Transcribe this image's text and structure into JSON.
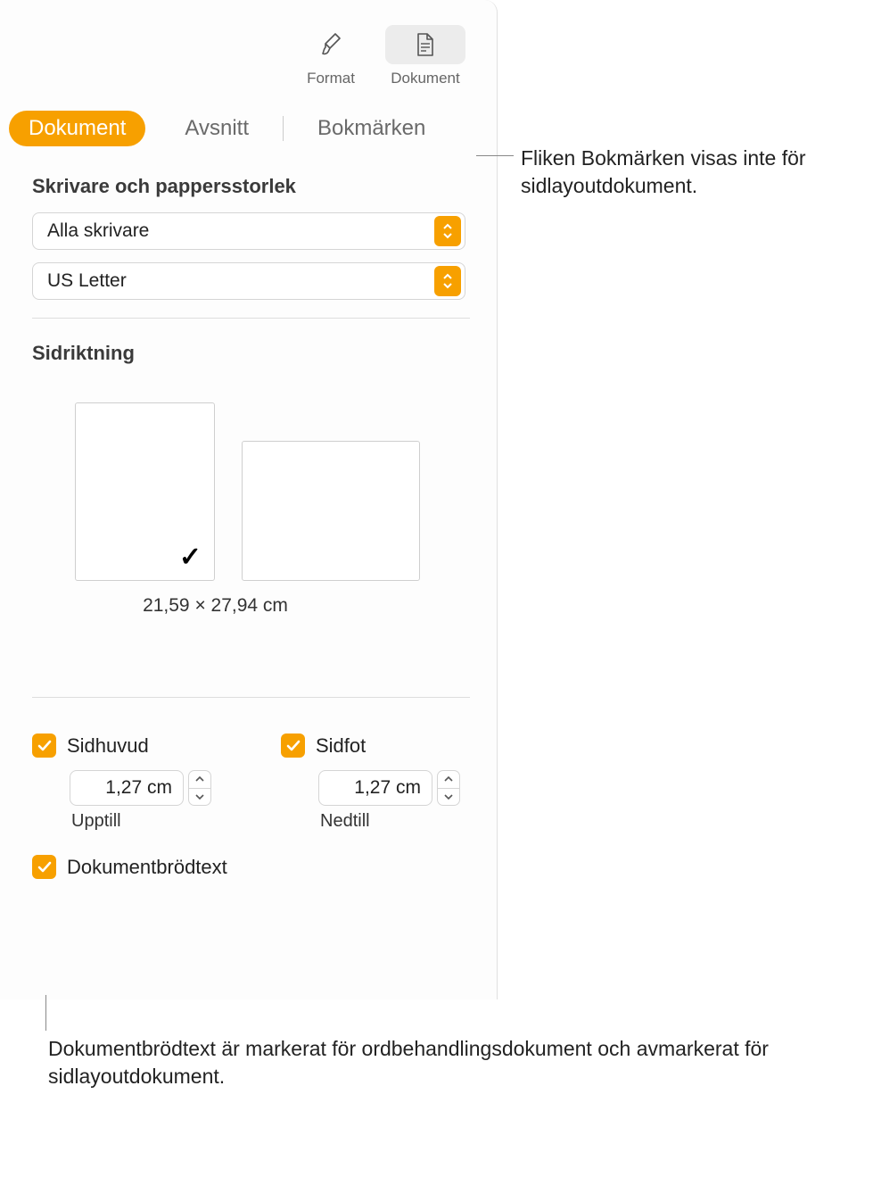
{
  "toolbar": {
    "format_label": "Format",
    "document_label": "Dokument"
  },
  "tabs": {
    "document": "Dokument",
    "section": "Avsnitt",
    "bookmarks": "Bokmärken"
  },
  "printer_section": {
    "title": "Skrivare och pappersstorlek",
    "printer_value": "Alla skrivare",
    "paper_value": "US Letter"
  },
  "orientation": {
    "title": "Sidriktning",
    "dimensions": "21,59 × 27,94 cm"
  },
  "header": {
    "label": "Sidhuvud",
    "value": "1,27 cm",
    "sublabel": "Upptill"
  },
  "footer": {
    "label": "Sidfot",
    "value": "1,27 cm",
    "sublabel": "Nedtill"
  },
  "bodytext": {
    "label": "Dokumentbrödtext"
  },
  "callouts": {
    "bookmarks": "Fliken Bokmärken visas inte för sidlayoutdokument.",
    "bodytext": "Dokumentbrödtext är markerat för ordbehandlingsdokument och avmarkerat för sidlayoutdokument."
  }
}
